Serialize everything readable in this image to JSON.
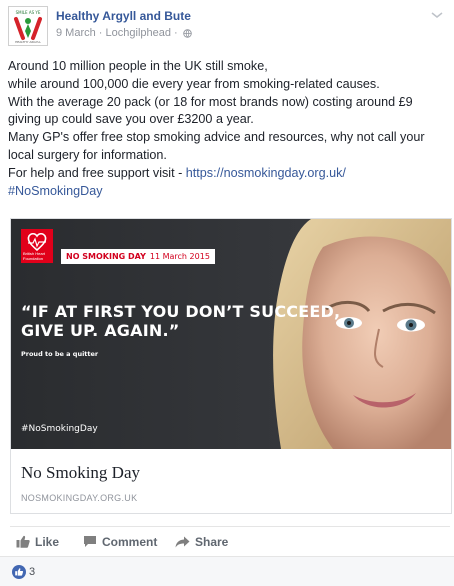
{
  "header": {
    "page_name": "Healthy Argyll and Bute",
    "date": "9 March",
    "location": "Lochgilphead"
  },
  "post": {
    "lines": [
      "Around 10 million people in the UK still smoke,",
      "while around 100,000 die every year from smoking-related causes.",
      "With the average 20 pack (or 18 for most brands now) costing around £9",
      "giving up could save you over £3200 a year.",
      "Many GP's offer free stop smoking advice and resources, why not call your",
      "local surgery for information."
    ],
    "help_text": "For help and free support visit - ",
    "help_link": "https://nosmokingday.org.uk/",
    "hashtag": "#NoSmokingDay"
  },
  "link_card": {
    "image": {
      "logo_text": "British Heart Foundation",
      "badge_title": "NO SMOKING DAY",
      "badge_date": "11 March 2015",
      "headline_line1": "“IF AT FIRST YOU DON’T SUCCEED,",
      "headline_line2": "GIVE UP. AGAIN.”",
      "tagline": "Proud to be a quitter",
      "hashtag": "#NoSmokingDay"
    },
    "title": "No Smoking Day",
    "domain": "NOSMOKINGDAY.ORG.UK"
  },
  "actions": {
    "like": "Like",
    "comment": "Comment",
    "share": "Share"
  },
  "reactions": {
    "count": "3"
  },
  "colors": {
    "link": "#365899",
    "brand_red": "#e1001a",
    "like_blue": "#4267b2"
  }
}
